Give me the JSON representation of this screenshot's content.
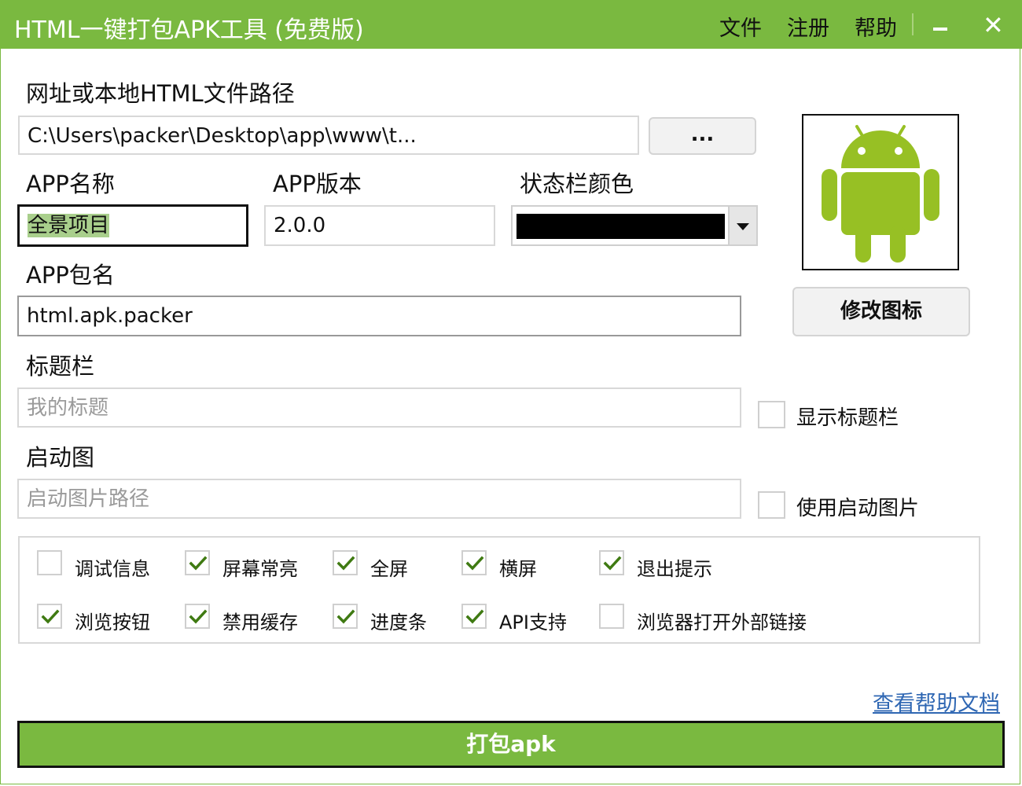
{
  "window": {
    "title": "HTML一键打包APK工具 (免费版)",
    "menu": [
      "文件",
      "注册",
      "帮助"
    ],
    "accent_color": "#7ab940"
  },
  "form": {
    "path": {
      "label": "网址或本地HTML文件路径",
      "value": "C:\\Users\\packer\\Desktop\\app\\www\\t...",
      "browse_label": "..."
    },
    "app_name": {
      "label": "APP名称",
      "value": "全景项目"
    },
    "app_version": {
      "label": "APP版本",
      "value": "2.0.0"
    },
    "status_bar_color": {
      "label": "状态栏颜色",
      "value_color": "#000000"
    },
    "package_name": {
      "label": "APP包名",
      "value": "html.apk.packer"
    },
    "title_bar": {
      "label": "标题栏",
      "placeholder": "我的标题",
      "checkbox_label": "显示标题栏",
      "checked": false
    },
    "splash": {
      "label": "启动图",
      "placeholder": "启动图片路径",
      "checkbox_label": "使用启动图片",
      "checked": false
    },
    "icon": {
      "name": "android-robot-icon",
      "change_label": "修改图标"
    }
  },
  "options": [
    {
      "label": "调试信息",
      "checked": false
    },
    {
      "label": "屏幕常亮",
      "checked": true
    },
    {
      "label": "全屏",
      "checked": true
    },
    {
      "label": "横屏",
      "checked": true
    },
    {
      "label": "退出提示",
      "checked": true
    },
    {
      "label": "浏览按钮",
      "checked": true
    },
    {
      "label": "禁用缓存",
      "checked": true
    },
    {
      "label": "进度条",
      "checked": true
    },
    {
      "label": "API支持",
      "checked": true
    },
    {
      "label": "浏览器打开外部链接",
      "checked": false
    }
  ],
  "footer": {
    "help_link": "查看帮助文档",
    "build_label": "打包apk"
  }
}
